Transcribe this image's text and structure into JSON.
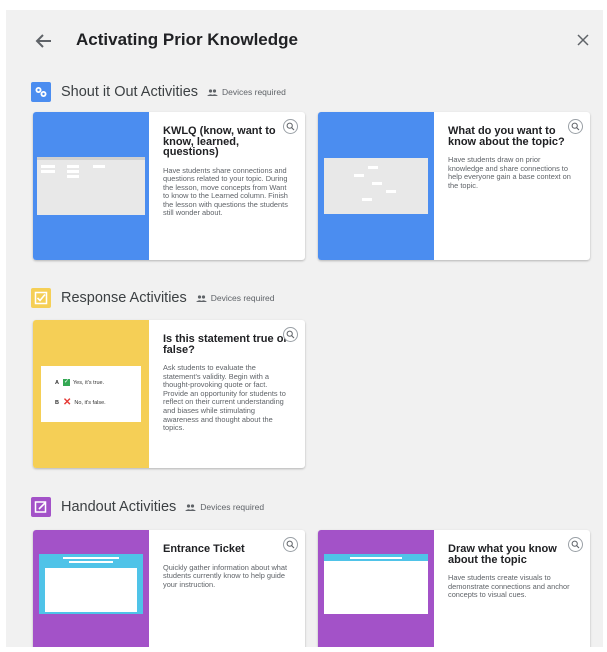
{
  "header": {
    "title": "Activating Prior Knowledge"
  },
  "devices_label": "Devices required",
  "sections": [
    {
      "title": "Shout it Out Activities",
      "color": "#4b8df0",
      "cards": [
        {
          "title": "KWLQ (know, want to know, learned, questions)",
          "description": "Have students share connections and questions related to your topic. During the lesson, move concepts from Want to know to the Learned column. Finish the lesson with questions the students still wonder about."
        },
        {
          "title": "What do you want to know about the topic?",
          "description": "Have students draw on prior knowledge and share connections to help everyone gain a base context on the topic."
        }
      ]
    },
    {
      "title": "Response Activities",
      "color": "#f5cf56",
      "cards": [
        {
          "title": "Is this statement true or false?",
          "description": "Ask students to evaluate the statement's validity. Begin with a thought-provoking quote or fact. Provide an opportunity for students to reflect on their current understanding and biases while stimulating awareness and thought about the topics.",
          "thumb": {
            "a_letter": "A",
            "a_text": "Yes, it's true.",
            "b_letter": "B",
            "b_text": "No, it's false."
          }
        }
      ]
    },
    {
      "title": "Handout Activities",
      "color": "#a352c8",
      "cards": [
        {
          "title": "Entrance Ticket",
          "description": "Quickly gather information about what students currently know to help guide your instruction."
        },
        {
          "title": "Draw what you know about the topic",
          "description": "Have students create visuals to demonstrate connections and anchor concepts to visual cues."
        }
      ]
    }
  ]
}
